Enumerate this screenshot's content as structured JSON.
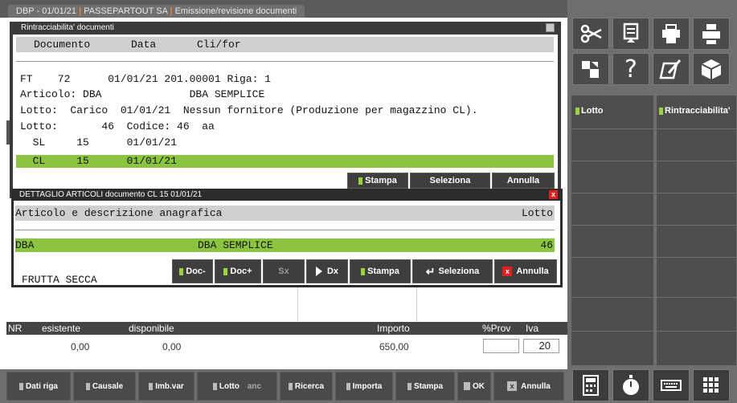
{
  "title": {
    "app": "DBP - 01/01/21",
    "company": "PASSEPARTOUT SA",
    "module": "Emissione/revisione documenti",
    "sep": "|"
  },
  "win1": {
    "title": "Rintracciabilita' documenti",
    "headers": [
      "Documento",
      "Data",
      "Cli/for"
    ],
    "lines": [
      "FT    72      01/01/21 201.00001 Riga: 1",
      "Articolo: DBA              DBA SEMPLICE",
      "Lotto:  Carico  01/01/21  Nessun fornitore (Produzione per magazzino CL).",
      "Lotto:       46  Codice: 46  aa",
      "  SL     15      01/01/21"
    ],
    "selected": "  CL     15      01/01/21",
    "buttons": [
      "Stampa",
      "Seleziona",
      "Annulla"
    ]
  },
  "win2": {
    "title": "DETTAGLIO ARTICOLI documento  CL   15    01/01/21",
    "close": "x",
    "header_left": "Articolo e descrizione anagrafica",
    "header_right": "Lotto",
    "row": {
      "code": "DBA",
      "desc": "DBA SEMPLICE",
      "lotto": "46"
    },
    "extra": "FRUTTA SECCA",
    "buttons": {
      "doc_prev": "Doc-",
      "doc_next": "Doc+",
      "sx": "Sx",
      "dx": "Dx",
      "stampa": "Stampa",
      "seleziona": "Seleziona",
      "annulla": "Annulla"
    }
  },
  "bottom": {
    "headers": {
      "nr": "NR",
      "esistente": "esistente",
      "disponibile": "disponibile",
      "importo": "Importo",
      "prov": "%Prov",
      "iva": "Iva"
    },
    "values": {
      "esistente": "0,00",
      "disponibile": "0,00",
      "importo": "650,00",
      "iva": "20"
    },
    "buttons": {
      "dati_riga": "Dati riga",
      "causale": "Causale",
      "imb_var": "Imb.var",
      "lotto": "Lotto",
      "anc": "anc",
      "ricerca": "Ricerca",
      "importa": "Importa",
      "stampa": "Stampa",
      "ok": "OK",
      "annulla": "Annulla"
    }
  },
  "right": {
    "lotto": "Lotto",
    "rintracciabilita": "Rintracciabilita'",
    "icons": [
      "scissors-icon",
      "document-icon",
      "printer-fold-icon",
      "printer-icon",
      "transfer-icon",
      "help-icon",
      "edit-icon",
      "cube-icon",
      "calculator-icon",
      "stopwatch-icon",
      "keyboard-icon",
      "keypad-icon"
    ]
  },
  "colors": {
    "accent": "#8bc53f",
    "dark": "#3b3b3b",
    "panel": "#6e6e6e",
    "close_red": "#e02020"
  }
}
